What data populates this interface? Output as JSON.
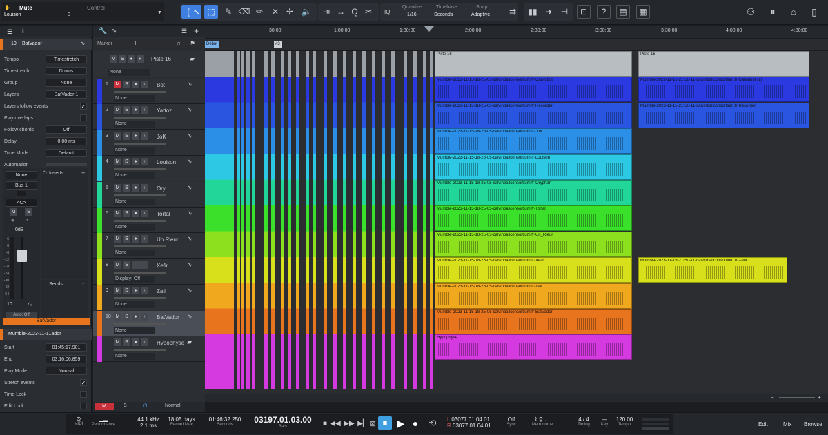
{
  "toolbar": {
    "left_top": "Mute",
    "left_bottom": "Louison",
    "left_num": "0",
    "control": "Control",
    "quantize_label": "Quantize",
    "quantize_value": "1/16",
    "timebase_label": "Timebase",
    "timebase_value": "Seconds",
    "snap_label": "Snap",
    "snap_value": "Adaptive",
    "iq": "IQ"
  },
  "inspector": {
    "track_num": "10",
    "track_name": "BatVador",
    "rows": [
      {
        "label": "Tempo",
        "value": "Timestretch"
      },
      {
        "label": "Timestretch",
        "value": "Drums"
      },
      {
        "label": "Group",
        "value": "None"
      },
      {
        "label": "Layers",
        "value": "BatVador 1"
      },
      {
        "label": "Layers follow events",
        "value": "✓"
      },
      {
        "label": "Play overlaps",
        "value": ""
      },
      {
        "label": "Follow chords",
        "value": "Off"
      },
      {
        "label": "Delay",
        "value": "0.00 ms"
      },
      {
        "label": "Tune Mode",
        "value": "Default"
      },
      {
        "label": "Automation",
        "value": ""
      }
    ],
    "mixer": {
      "input": "None",
      "bus": "Bus 1",
      "pan": "<C>",
      "m": "M",
      "s": "S",
      "db": "0dB",
      "inserts": "Inserts",
      "sends": "Sends",
      "num": "10",
      "auto": "Auto: Off",
      "channel_name": "BatVador",
      "scale": [
        "6",
        "0",
        "-6",
        "-12",
        "-18",
        "-24",
        "-30",
        "-42",
        "-54"
      ]
    },
    "event_name": "Mumble-2023-11-1..ador",
    "event_rows": [
      {
        "label": "Start",
        "value": "01:45:17.901"
      },
      {
        "label": "End",
        "value": "03:16:06.859"
      },
      {
        "label": "Play Mode",
        "value": "Normal"
      },
      {
        "label": "Stretch events",
        "value": "✓"
      },
      {
        "label": "Time Lock",
        "value": ""
      },
      {
        "label": "Edit Lock",
        "value": ""
      }
    ]
  },
  "tracklist": {
    "marker": "Marker",
    "folder_name": "Piste 16",
    "folder_none": "None",
    "bottom_mode": "Normal",
    "tracks": [
      {
        "num": "1",
        "name": "Bot",
        "color": "#2a3ae0",
        "none": "None"
      },
      {
        "num": "2",
        "name": "Yattoz",
        "color": "#2a55e0",
        "none": "None"
      },
      {
        "num": "3",
        "name": "JoK",
        "color": "#2b8fe8",
        "none": "None"
      },
      {
        "num": "4",
        "name": "Louison",
        "color": "#2cc8e4",
        "none": "None"
      },
      {
        "num": "5",
        "name": "Ory",
        "color": "#22d69a",
        "none": "None"
      },
      {
        "num": "6",
        "name": "Tortal",
        "color": "#3ae02a",
        "none": "None"
      },
      {
        "num": "7",
        "name": "Un Rieur",
        "color": "#8de01e",
        "none": "None"
      },
      {
        "num": "8",
        "name": "Xefir",
        "color": "#d8e01c",
        "none": "Display: Off"
      },
      {
        "num": "9",
        "name": "Zali",
        "color": "#f0a81e",
        "none": "None"
      },
      {
        "num": "10",
        "name": "BatVador",
        "color": "#e8741e",
        "none": "None"
      },
      {
        "num": "",
        "name": "Hypophyse",
        "color": "#d43ae0",
        "none": "None"
      }
    ]
  },
  "ruler": [
    "30:00",
    "1:00:00",
    "1:30:00",
    "2:00:00",
    "2:30:00",
    "3:00:00",
    "3:30:00",
    "4:00:00",
    "4:30:00"
  ],
  "markers": {
    "start": "Début",
    "m3": "#3"
  },
  "clips": {
    "piste16_a": "Piste 16",
    "piste16_b": "Piste 16",
    "names": [
      "Mumble-2023-11-15-18-25-05-calvinballconsortium.fr-Calvinbot",
      "Mumble-2023-11-15-18-25-05-calvinballconsortium.fr-Recorder",
      "Mumble-2023-11-15-18-25-05-calvinballconsortium.fr-JoK",
      "Mumble-2023-11-15-18-25-05-calvinballconsortium.fr-Louison",
      "Mumble-2023-11-15-18-25-05-calvinballconsortium.fr-Oryphan",
      "Mumble-2023-11-15-18-25-05-calvinballconsortium.fr-Tortal",
      "Mumble-2023-11-15-18-25-05-calvinballconsortium.fr-Un_Rieur",
      "Mumble-2023-11-15-18-25-05-calvinballconsortium.fr-Xefir",
      "Mumble-2023-11-15-18-25-05-calvinballconsortium.fr-Zali",
      "Mumble-2023-11-15-18-25-05-calvinballconsortium.fr-BatVador",
      "Hypophyse"
    ],
    "second": {
      "bot": "Mumble-2023-11-15-21-50-11-calvinballconsortium.fr-Calvinbot (1)",
      "rec": "Mumble-2023-11-15-21-50-11-calvinballconsortium.fr-Recorder",
      "xef": "Mumble-2023-11-15-21-50-11-calvinballconsortium.fr-Xefir"
    }
  },
  "transport": {
    "midi": "MIDI",
    "performance": "Performance",
    "rate": "44.1 kHz",
    "latency": "2.1 ms",
    "days": "18:05 days",
    "record_max": "Record Max",
    "time": "01:46:32.250",
    "seconds": "Seconds",
    "bars_val": "03197.01.03.00",
    "bars": "Bars",
    "l": "03077.01.04.01",
    "r": "03077.01.04.01",
    "sync_val": "Off",
    "sync": "Sync",
    "metronome": "Metronome",
    "timing_val": "4 / 4",
    "timing": "Timing",
    "key": "Key",
    "tempo_val": "120.00",
    "tempo": "Tempo",
    "edit": "Edit",
    "mix": "Mix",
    "browse": "Browse"
  }
}
